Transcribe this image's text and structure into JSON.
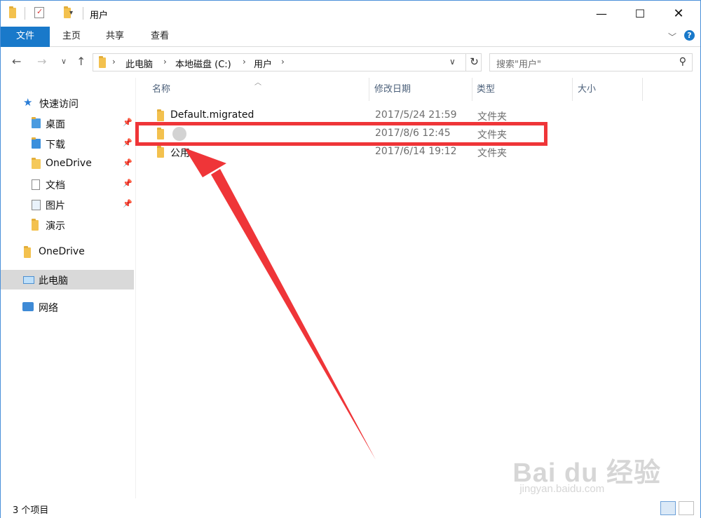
{
  "window": {
    "title": "用户"
  },
  "ribbon": {
    "tabs": [
      "文件",
      "主页",
      "共享",
      "查看"
    ]
  },
  "address": {
    "crumbs": [
      "此电脑",
      "本地磁盘 (C:)",
      "用户"
    ]
  },
  "search": {
    "placeholder": "搜索\"用户\""
  },
  "sidebar": {
    "quick_access": "快速访问",
    "items": [
      {
        "label": "桌面",
        "icon": "desktop-icon",
        "pinned": true
      },
      {
        "label": "下载",
        "icon": "downloads-icon",
        "pinned": true
      },
      {
        "label": "OneDrive",
        "icon": "onedrive-icon",
        "pinned": true
      },
      {
        "label": "文档",
        "icon": "documents-icon",
        "pinned": true
      },
      {
        "label": "图片",
        "icon": "pictures-icon",
        "pinned": true
      },
      {
        "label": "演示",
        "icon": "folder-icon",
        "pinned": false
      }
    ],
    "onedrive": "OneDrive",
    "this_pc": "此电脑",
    "network": "网络"
  },
  "columns": {
    "name": "名称",
    "date": "修改日期",
    "type": "类型",
    "size": "大小"
  },
  "files": [
    {
      "name": "Default.migrated",
      "date": "2017/5/24 21:59",
      "type": "文件夹"
    },
    {
      "name": "",
      "date": "2017/8/6 12:45",
      "type": "文件夹"
    },
    {
      "name": "公用",
      "date": "2017/6/14 19:12",
      "type": "文件夹"
    }
  ],
  "status": {
    "count": "3 个项目"
  },
  "watermark": {
    "brand": "Bai du 经验",
    "url": "jingyan.baidu.com"
  },
  "colors": {
    "accent": "#1979ca",
    "highlight": "#ef3538",
    "selected": "#d9d9d9"
  }
}
